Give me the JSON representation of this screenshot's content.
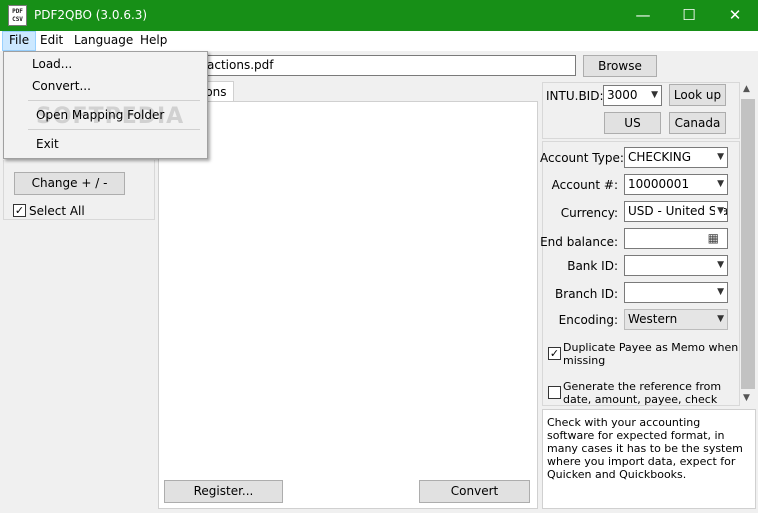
{
  "window": {
    "title": "PDF2QBO (3.0.6.3)",
    "icon_text_top": "PDF",
    "icon_text_bottom": "CSV",
    "minimize": "—",
    "maximize": "☐",
    "close": "✕"
  },
  "menu": {
    "file": "File",
    "edit": "Edit",
    "language": "Language",
    "help": "Help"
  },
  "file_menu": {
    "load": "Load...",
    "convert": "Convert...",
    "open_mapping_folder": "Open Mapping Folder",
    "exit": "Exit"
  },
  "watermark": "SOFTPEDIA",
  "toolbar": {
    "file_path": "actions.pdf",
    "browse": "Browse"
  },
  "tab": {
    "label": "ions"
  },
  "left_panel": {
    "change_sign": "Change + / -",
    "select_all": "Select All",
    "select_all_checked": "✓"
  },
  "bottom": {
    "register": "Register...",
    "convert": "Convert"
  },
  "right_panel": {
    "intu_bid_label": "INTU.BID:",
    "intu_bid_value": "3000",
    "lookup": "Look up",
    "us": "US",
    "canada": "Canada",
    "account_type_label": "Account Type:",
    "account_type_value": "CHECKING",
    "account_num_label": "Account #:",
    "account_num_value": "10000001",
    "currency_label": "Currency:",
    "currency_value": "USD - United Sta",
    "end_balance_label": "End balance:",
    "end_balance_value": "",
    "calculator_icon": "▦",
    "bank_id_label": "Bank ID:",
    "bank_id_value": "",
    "branch_id_label": "Branch ID:",
    "branch_id_value": "",
    "encoding_label": "Encoding:",
    "encoding_value": "Western",
    "dup_payee_line1": "Duplicate Payee as Memo when",
    "dup_payee_line2": "missing",
    "dup_payee_checked": "✓",
    "gen_ref_line1": "Generate the reference from",
    "gen_ref_line2": "date, amount, payee, check",
    "info_text": "Check with your accounting software for expected format, in many cases it has to be the system where you import data, expect for Quicken and Quickbooks."
  }
}
